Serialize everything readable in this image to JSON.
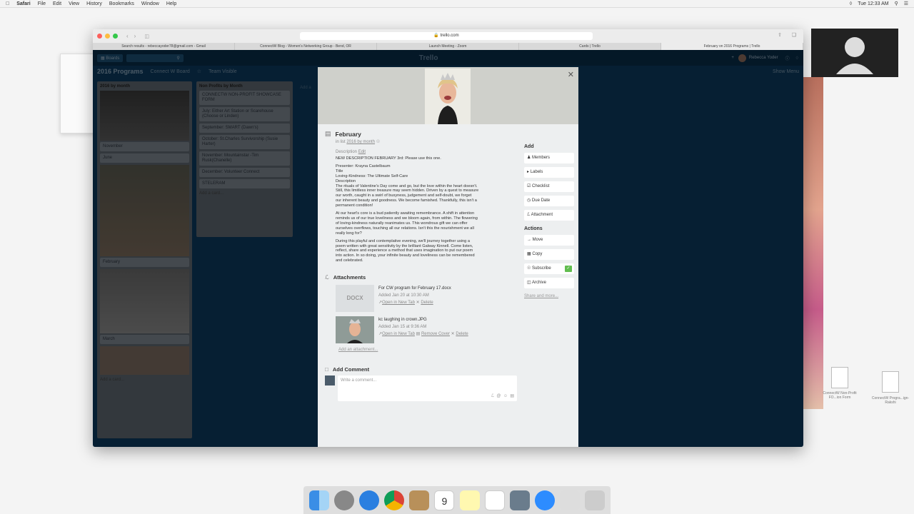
{
  "menubar": {
    "app": "Safari",
    "items": [
      "File",
      "Edit",
      "View",
      "History",
      "Bookmarks",
      "Window",
      "Help"
    ],
    "clock": "Tue 12:33 AM"
  },
  "browser": {
    "url": "trello.com",
    "tabs": [
      {
        "label": "Search results - rebeccayoder78@gmail.com - Gmail",
        "active": false
      },
      {
        "label": "ConnectW Blog - Women's Networking Group - Bend, OR",
        "active": false
      },
      {
        "label": "Launch Meeting - Zoom",
        "active": false
      },
      {
        "label": "Cards | Trello",
        "active": false
      },
      {
        "label": "February on 2016 Programs | Trello",
        "active": true
      }
    ]
  },
  "trello": {
    "boards_label": "Boards",
    "logo": "Trello",
    "user": "Rebecca Yoder",
    "board_title": "2016 Programs",
    "org": "Connect W Board",
    "visibility": "Team Visible",
    "show_menu": "Show Menu",
    "add_list": "Add a",
    "lists": [
      {
        "title": "2016 by month",
        "cards": [
          "November",
          "June",
          "February",
          "March"
        ],
        "add": "Add a card..."
      },
      {
        "title": "Non Profits by Month",
        "cards": [
          "CONNECTW NON-PROFIT SHOWCASE FORM",
          "July: Either Art Station or Scarehouse (Choose or Linden)",
          "September: SMART (Dawn's)",
          "October: St.Charles Survivorship (Susie Harter)",
          "November: Mountainstar -Tim Rusk(Chanelle)",
          "December: Volunteer Connect",
          "STELERAM"
        ],
        "add": "Add a card..."
      }
    ]
  },
  "card": {
    "title": "February",
    "in_list_prefix": "in list",
    "list_link": "2016 by month",
    "desc_label": "Description",
    "desc_edit": "Edit",
    "desc_lines": [
      "NEW DESCRIPTION FEBRUARY 3rd: Please use this one.",
      "",
      "Presenter: Krayna Castelbaum",
      "Title",
      "Loving-Kindness: The Ultimate Self-Care",
      "Description",
      "The rituals of Valentine's Day come and go, but the love within the heart doesn't.",
      "Still, this limitless inner treasure may seem hidden. Driven by a quest to measure",
      "our worth, caught in a swirl of busyness, judgement and self-doubt, we forget",
      "our inherent beauty and goodness. We become famished. Thankfully, this isn't a",
      "permanent condition!",
      "",
      "At our heart's core is a bud patiently awaiting remembrance. A shift in attention",
      "reminds us of our true loveliness and we bloom again, from within. The flowering",
      "of loving-kindness naturally reanimates us. This wondrous gift we can offer",
      "ourselves overflows, touching all our relations. Isn't this the nourishment we all",
      "really long for?",
      "",
      "During this playful and contemplative evening, we'll journey together using a",
      "poem written with great sensitivity by the brilliant Galway Kinnell. Come listen,",
      "reflect, share and experience a method that uses imagination to put our poem",
      "into action. In so doing, your infinite beauty and loveliness can be remembered",
      "and celebrated."
    ],
    "attachments_title": "Attachments",
    "attachments": [
      {
        "thumb": "DOCX",
        "name": "For CW program for February 17.docx",
        "added": "Added Jan 20 at 10:30 AM",
        "open": "Open in New Tab",
        "remove_cover": "",
        "delete": "Delete"
      },
      {
        "thumb": "",
        "name": "kc laughing in crown.JPG",
        "added": "Added Jan 15 at 9:36 AM",
        "open": "Open in New Tab",
        "remove_cover": "Remove Cover",
        "delete": "Delete"
      }
    ],
    "add_attachment": "Add an attachment...",
    "add_comment_title": "Add Comment",
    "comment_placeholder": "Write a comment...",
    "add_heading": "Add",
    "add_buttons": [
      "Members",
      "Labels",
      "Checklist",
      "Due Date",
      "Attachment"
    ],
    "actions_heading": "Actions",
    "action_buttons": [
      "Move",
      "Copy",
      "Subscribe",
      "Archive"
    ],
    "share": "Share and more..."
  },
  "desktop_files": [
    {
      "name": "ConnectW Non-Profit FO...ion Form"
    },
    {
      "name": "ConnectW Progra...ign-Rakshi"
    }
  ],
  "colors": {
    "trello_bg": "#0c3a5e",
    "subscribe_check": "#61bd4f"
  }
}
